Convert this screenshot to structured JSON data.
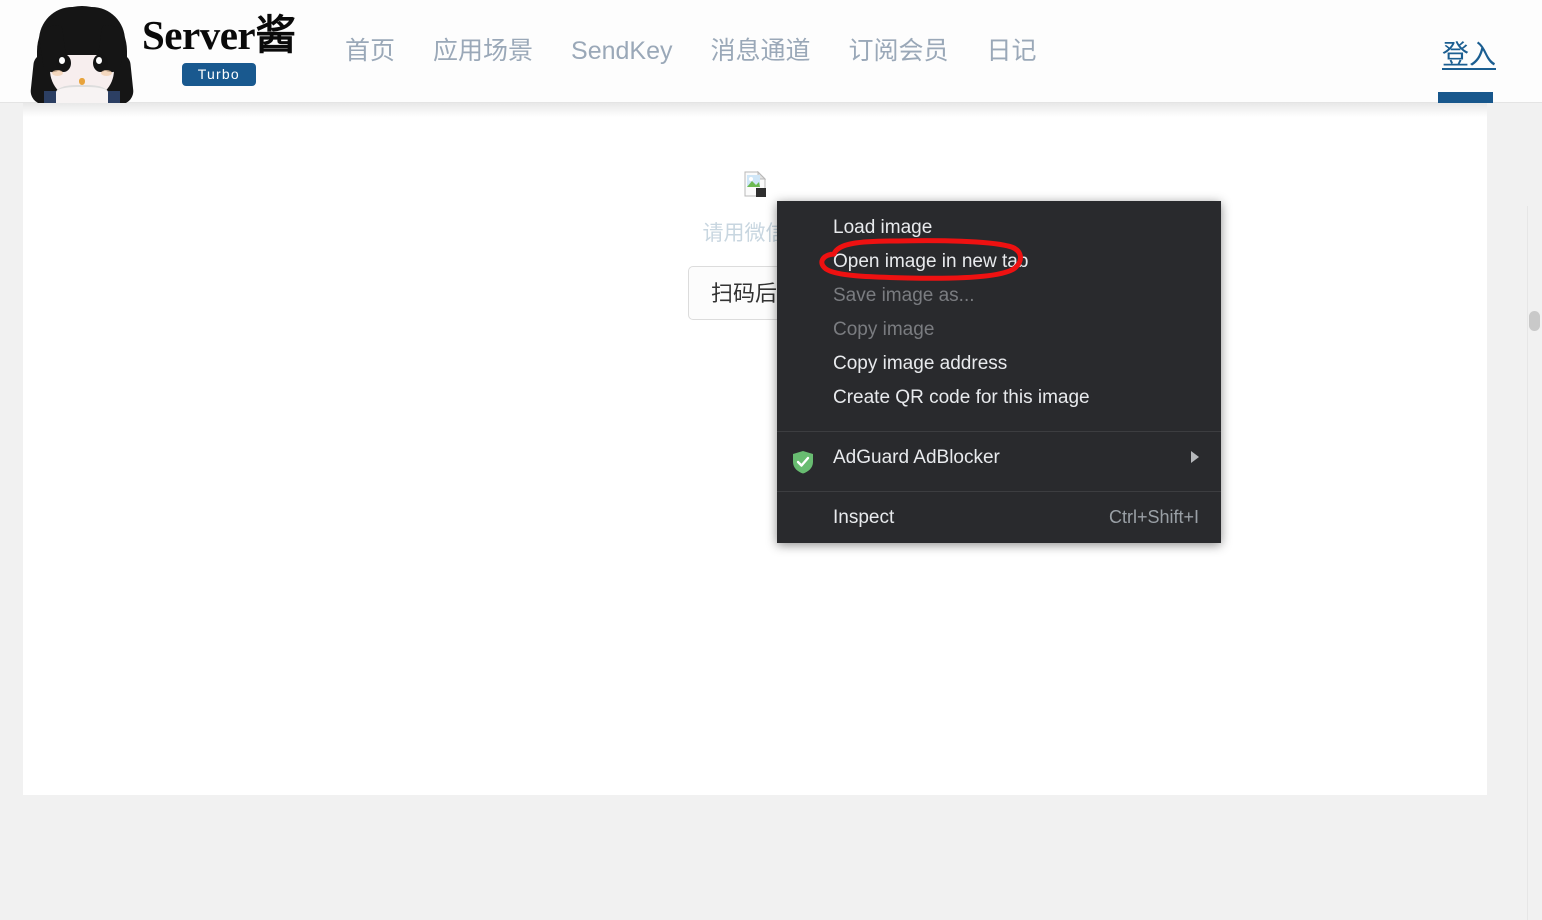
{
  "header": {
    "brand": {
      "avatar_icon": "mascot-avatar-icon",
      "title": "Server酱",
      "badge": "Turbo"
    },
    "nav": [
      {
        "label": "首页"
      },
      {
        "label": "应用场景"
      },
      {
        "label": "SendKey"
      },
      {
        "label": "消息通道"
      },
      {
        "label": "订阅会员"
      },
      {
        "label": "日记"
      }
    ],
    "login": {
      "label": "登入",
      "indicator_color": "#18578c"
    }
  },
  "main": {
    "qr": {
      "broken_image_icon": "broken-image-icon",
      "hint": "请用微信扫",
      "button": "扫码后点"
    }
  },
  "context_menu": {
    "groups": [
      {
        "items": [
          {
            "label": "Load image",
            "disabled": false,
            "shortcut": "",
            "icon": "",
            "submenu": false
          },
          {
            "label": "Open image in new tab",
            "disabled": false,
            "shortcut": "",
            "icon": "",
            "submenu": false
          },
          {
            "label": "Save image as...",
            "disabled": true,
            "shortcut": "",
            "icon": "",
            "submenu": false
          },
          {
            "label": "Copy image",
            "disabled": true,
            "shortcut": "",
            "icon": "",
            "submenu": false
          },
          {
            "label": "Copy image address",
            "disabled": false,
            "shortcut": "",
            "icon": "",
            "submenu": false
          },
          {
            "label": "Create QR code for this image",
            "disabled": false,
            "shortcut": "",
            "icon": "",
            "submenu": false
          }
        ]
      },
      {
        "items": [
          {
            "label": "AdGuard AdBlocker",
            "disabled": false,
            "shortcut": "",
            "icon": "adguard-shield-icon",
            "submenu": true
          }
        ]
      },
      {
        "items": [
          {
            "label": "Inspect",
            "disabled": false,
            "shortcut": "Ctrl+Shift+I",
            "icon": "",
            "submenu": false
          }
        ]
      }
    ]
  },
  "annotation": {
    "shape": "hand-drawn-ellipse",
    "color": "#ee1111",
    "targets": "Open image in new tab"
  },
  "colors": {
    "menu_background": "#292a2d",
    "menu_text": "#e8eaed",
    "menu_text_disabled": "#7a7c80",
    "brand_badge": "#19598f",
    "nav_text": "#9aa8b8",
    "login_text": "#1b5e91",
    "adguard_green": "#68bc71",
    "page_background": "#f1f1f1",
    "card_background": "#ffffff"
  }
}
